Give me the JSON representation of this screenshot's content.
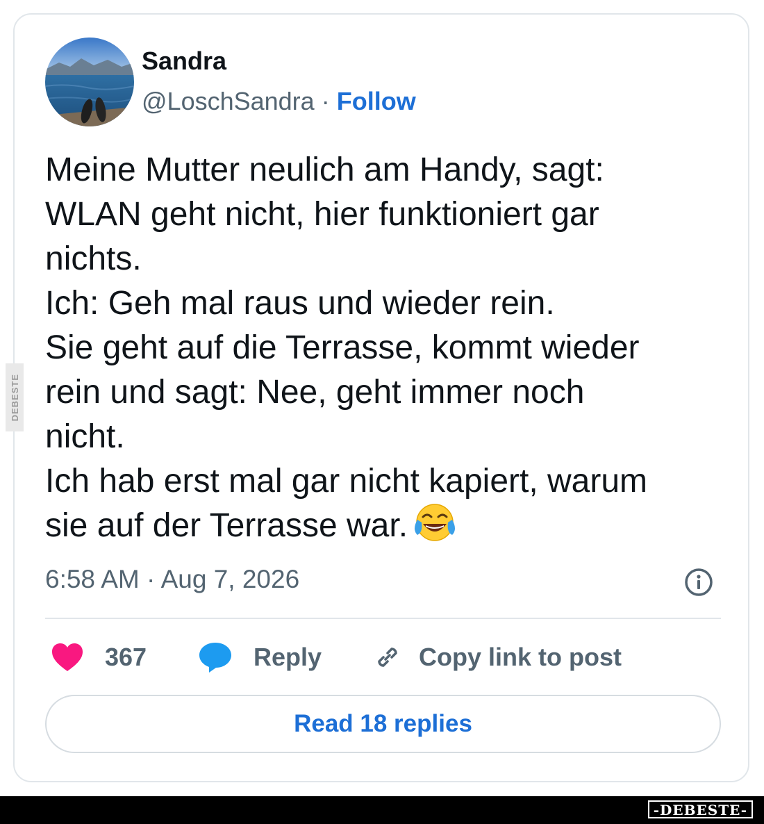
{
  "tweet": {
    "author_name": "Sandra",
    "handle": "@LoschSandra",
    "separator": "·",
    "follow_label": "Follow",
    "text_lines": [
      "Meine Mutter neulich am Handy, sagt:",
      "WLAN geht nicht, hier funktioniert gar",
      "nichts.",
      "Ich: Geh mal raus und wieder rein.",
      "Sie geht auf die Terrasse, kommt wieder",
      "rein und sagt: Nee, geht immer noch",
      "nicht.",
      "Ich hab erst mal gar nicht kapiert, warum",
      "sie auf der Terrasse war."
    ],
    "emoji": "face-with-tears-of-joy",
    "timestamp": "6:58 AM · Aug 7, 2026"
  },
  "actions": {
    "like_count": "367",
    "reply_label": "Reply",
    "copy_link_label": "Copy link to post"
  },
  "read_replies_label": "Read 18 replies",
  "watermark_side": "DEBESTE",
  "watermark_footer": "-DEBESTE-",
  "colors": {
    "link_blue": "#1d6fd6",
    "like_pink": "#f91880",
    "reply_blue": "#1d9bf0",
    "secondary_text": "#536471"
  }
}
